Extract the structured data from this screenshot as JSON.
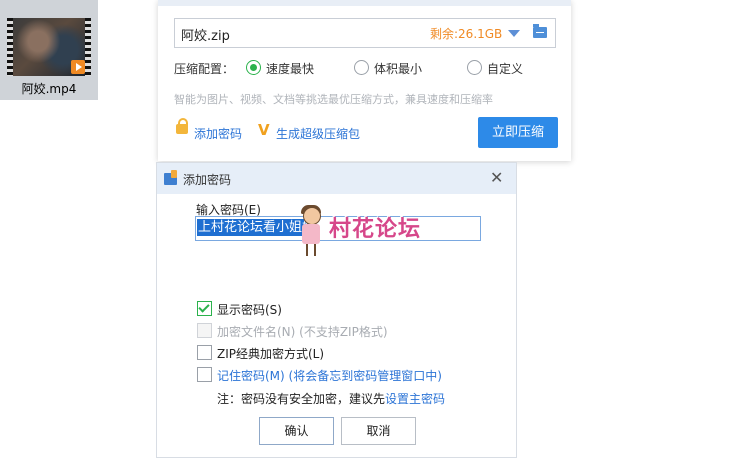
{
  "desktop": {
    "file_name": "阿姣.mp4",
    "file_icon": "video-file-icon"
  },
  "compress": {
    "zip_name": "阿姣.zip",
    "remaining": "剩余:26.1GB",
    "config_label": "压缩配置：",
    "options": [
      "速度最快",
      "体积最小",
      "自定义"
    ],
    "selected_option": "速度最快",
    "hint": "智能为图片、视频、文档等挑选最优压缩方式，兼具速度和压缩率",
    "add_password": "添加密码",
    "super_pack": "生成超级压缩包",
    "compress_button": "立即压缩",
    "colors": {
      "accent": "#2d8ae8",
      "remain": "#f08a24",
      "radio_on": "#2bb24c"
    }
  },
  "password_dialog": {
    "title": "添加密码",
    "close": "✕",
    "input_label": "输入密码(E)",
    "password_value": "上村花论坛看小姐姐",
    "watermark": "村花论坛",
    "checkboxes": [
      {
        "label": "显示密码(S)",
        "checked": true,
        "disabled": false
      },
      {
        "label": "加密文件名(N) (不支持ZIP格式)",
        "checked": false,
        "disabled": true
      },
      {
        "label": "ZIP经典加密方式(L)",
        "checked": false,
        "disabled": false
      },
      {
        "label": "记住密码(M) (将会备忘到密码管理窗口中)",
        "checked": false,
        "disabled": false
      }
    ],
    "note_prefix": "注：密码没有安全加密，建议先",
    "note_link": "设置主密码",
    "ok_button": "确认",
    "cancel_button": "取消"
  }
}
